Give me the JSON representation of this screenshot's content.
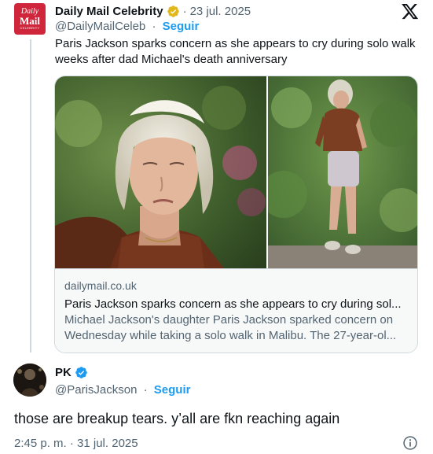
{
  "quoted": {
    "avatar": {
      "line1": "Daily",
      "line2": "Mail",
      "line3": "CELEBRITY",
      "color": "#d0263c"
    },
    "display_name": "Daily Mail Celebrity",
    "separator": "·",
    "date": "23 jul. 2025",
    "handle": "@DailyMailCeleb",
    "follow_label": "Seguir",
    "text": "Paris Jackson sparks concern as she appears to cry during solo walk weeks after dad Michael's death anniversary",
    "card": {
      "domain": "dailymail.co.uk",
      "title": "Paris Jackson sparks concern as she appears to cry during sol...",
      "description_line1": "Michael Jackson's daughter Paris Jackson sparked concern on",
      "description_line2": "Wednesday while taking a solo walk in Malibu. The 27-year-ol..."
    }
  },
  "reply": {
    "display_name": "PK",
    "handle": "@ParisJackson",
    "separator": "·",
    "follow_label": "Seguir",
    "text": "those are breakup tears. y’all are fkn reaching again",
    "timestamp": "2:45 p. m. · 31 jul. 2025"
  },
  "icons": {
    "verified": "verified-badge-icon",
    "x_logo": "x-logo-icon",
    "info": "info-icon"
  },
  "colors": {
    "accent": "#1d9bf0",
    "verified_gold": "#e2b719",
    "text_secondary": "#536471",
    "border": "#cfd9de"
  }
}
